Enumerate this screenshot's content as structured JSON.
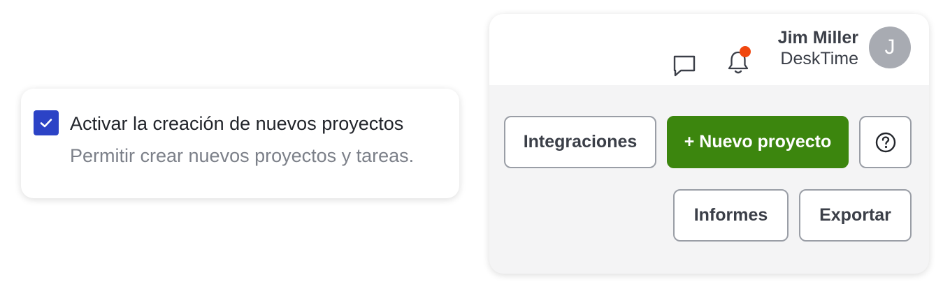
{
  "settings_card": {
    "checkbox_checked": true,
    "checkbox_color": "#2c43c6",
    "title": "Activar la creación de nuevos proyectos",
    "description": "Permitir crear nuevos proyectos y tareas."
  },
  "header": {
    "chat_icon": "chat-bubble-icon",
    "bell_icon": "bell-icon",
    "has_notification": true,
    "notification_color": "#f0470f",
    "user": {
      "name": "Jim Miller",
      "organization": "DeskTime",
      "avatar_initial": "J"
    }
  },
  "actions": {
    "integrations_label": "Integraciones",
    "new_project_label": "+ Nuevo proyecto",
    "help_icon": "question-circle-icon",
    "reports_label": "Informes",
    "export_label": "Exportar",
    "primary_color": "#3c860e"
  }
}
